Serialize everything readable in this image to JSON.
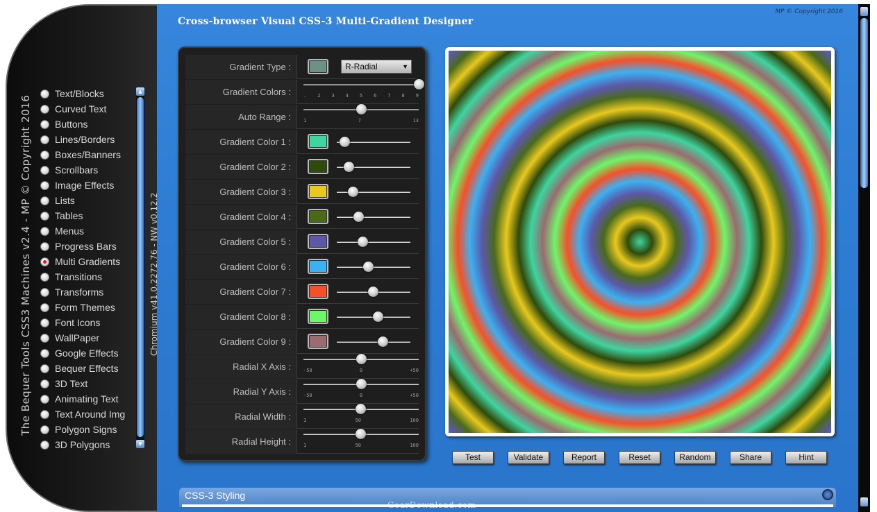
{
  "sidebar": {
    "vertical_title": "The Bequer Tools CSS3 Machines v2.4 - MP © Copyright 2016",
    "version": "Chromium v41.0.2272.76 - NW v0.12.2",
    "items": [
      {
        "label": "Text/Blocks",
        "selected": false
      },
      {
        "label": "Curved Text",
        "selected": false
      },
      {
        "label": "Buttons",
        "selected": false
      },
      {
        "label": "Lines/Borders",
        "selected": false
      },
      {
        "label": "Boxes/Banners",
        "selected": false
      },
      {
        "label": "Scrollbars",
        "selected": false
      },
      {
        "label": "Image Effects",
        "selected": false
      },
      {
        "label": "Lists",
        "selected": false
      },
      {
        "label": "Tables",
        "selected": false
      },
      {
        "label": "Menus",
        "selected": false
      },
      {
        "label": "Progress Bars",
        "selected": false
      },
      {
        "label": "Multi Gradients",
        "selected": true
      },
      {
        "label": "Transitions",
        "selected": false
      },
      {
        "label": "Transforms",
        "selected": false
      },
      {
        "label": "Form Themes",
        "selected": false
      },
      {
        "label": "Font Icons",
        "selected": false
      },
      {
        "label": "WallPaper",
        "selected": false
      },
      {
        "label": "Google Effects",
        "selected": false
      },
      {
        "label": "Bequer Effects",
        "selected": false
      },
      {
        "label": "3D Text",
        "selected": false
      },
      {
        "label": "Animating Text",
        "selected": false
      },
      {
        "label": "Text Around Img",
        "selected": false
      },
      {
        "label": "Polygon Signs",
        "selected": false
      },
      {
        "label": "3D Polygons",
        "selected": false
      }
    ]
  },
  "header": {
    "title": "Cross-browser Visual CSS-3 Multi-Gradient Designer",
    "copyright": "MP © Copyright 2016"
  },
  "controls": {
    "gradient_type": {
      "label": "Gradient Type :",
      "swatch": "#6b9188",
      "value": "R-Radial"
    },
    "gradient_colors": {
      "label": "Gradient Colors :",
      "ticks": [
        ".",
        "2",
        "3",
        "4",
        "5",
        "6",
        "7",
        "8",
        "9"
      ],
      "value": 9
    },
    "auto_range": {
      "label": "Auto Range :",
      "ticks": [
        "1",
        "7",
        "13"
      ],
      "value": 7
    },
    "colors": [
      {
        "label": "Gradient Color 1 :",
        "hex": "#3fd4a0",
        "level": 0.1
      },
      {
        "label": "Gradient Color 2 :",
        "hex": "#2e4a0c",
        "level": 0.16
      },
      {
        "label": "Gradient Color 3 :",
        "hex": "#e8c81f",
        "level": 0.22
      },
      {
        "label": "Gradient Color 4 :",
        "hex": "#4a6a1a",
        "level": 0.29
      },
      {
        "label": "Gradient Color 5 :",
        "hex": "#5c58a8",
        "level": 0.35
      },
      {
        "label": "Gradient Color 6 :",
        "hex": "#3cb0f0",
        "level": 0.42
      },
      {
        "label": "Gradient Color 7 :",
        "hex": "#f6502a",
        "level": 0.49
      },
      {
        "label": "Gradient Color 8 :",
        "hex": "#6ef56a",
        "level": 0.56
      },
      {
        "label": "Gradient Color 9 :",
        "hex": "#9a6b70",
        "level": 0.62
      }
    ],
    "radial_x": {
      "label": "Radial X Axis :",
      "ticks": [
        "-50",
        "0",
        "+50"
      ],
      "value": 0
    },
    "radial_y": {
      "label": "Radial Y Axis :",
      "ticks": [
        "-50",
        "0",
        "+50"
      ],
      "value": 0
    },
    "radial_width": {
      "label": "Radial Width :",
      "ticks": [
        "1",
        "50",
        "100"
      ],
      "value": 50
    },
    "radial_height": {
      "label": "Radial Height :",
      "ticks": [
        "1",
        "50",
        "100"
      ],
      "value": 50
    }
  },
  "buttons": [
    "Test",
    "Validate",
    "Report",
    "Reset",
    "Random",
    "Share",
    "Hint"
  ],
  "css_section": {
    "title": "CSS-3 Styling"
  },
  "watermark": "GearDownload.com"
}
